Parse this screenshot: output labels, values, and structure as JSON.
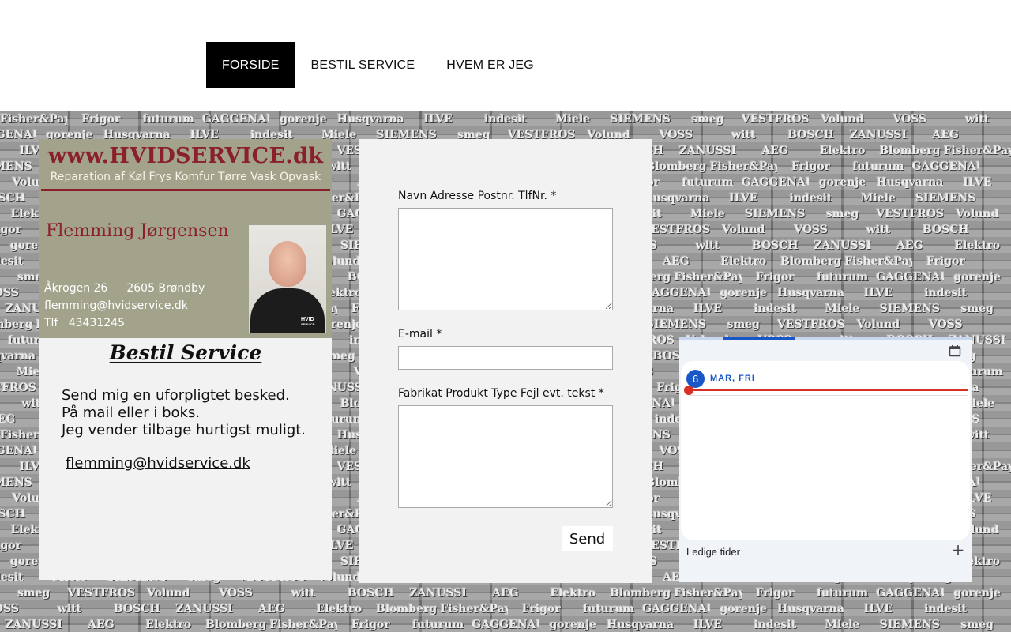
{
  "nav": {
    "items": [
      {
        "label": "FORSIDE",
        "active": true
      },
      {
        "label": "BESTIL SERVICE",
        "active": false
      },
      {
        "label": "HVEM ER JEG",
        "active": false
      }
    ]
  },
  "background": {
    "brand_logos": [
      "Fisher&Paykel",
      "Frigor",
      "futurum",
      "GAGGENAU",
      "gorenje",
      "Husqvarna",
      "ILVE",
      "indesit",
      "Miele",
      "SIEMENS",
      "smeg",
      "VESTFROST",
      "Volund",
      "VOSS",
      "witt",
      "BOSCH",
      "ZANUSSI",
      "AEG",
      "Elektro",
      "Blomberg"
    ]
  },
  "business_card": {
    "url": "www.HVIDSERVICE.dk",
    "services": "Reparation af Køl Frys Komfur Tørre Vask Opvask",
    "name": "Flemming Jørgensen",
    "street": "Åkrogen 26",
    "postcode_city": "2605 Brøndby",
    "email": "flemming@hvidservice.dk",
    "phone": "Tlf   43431245",
    "photo_logo_main": "HVID",
    "photo_logo_sub": "SERVICE"
  },
  "left_card": {
    "heading": "Bestil Service",
    "line1": "Send mig en uforpligtet besked.",
    "line2": "På mail eller i boks.",
    "line3": "Jeg vender tilbage hurtigst muligt.",
    "email_link": "flemming@hvidservice.dk"
  },
  "form": {
    "field1_label": "Navn Adresse Postnr. TlfNr. *",
    "field1_value": "",
    "email_label": "E-mail *",
    "email_value": "",
    "field3_label": "Fabrikat Produkt Type Fejl evt. tekst *",
    "field3_value": "",
    "send_label": "Send"
  },
  "booking": {
    "day_number": "6",
    "day_name": "MAR, FRI",
    "footer_label": "Ledige tider",
    "add_icon": "plus-icon",
    "calendar_icon": "calendar-icon",
    "accent_color": "#1a57c6",
    "now_color": "#d93025"
  }
}
